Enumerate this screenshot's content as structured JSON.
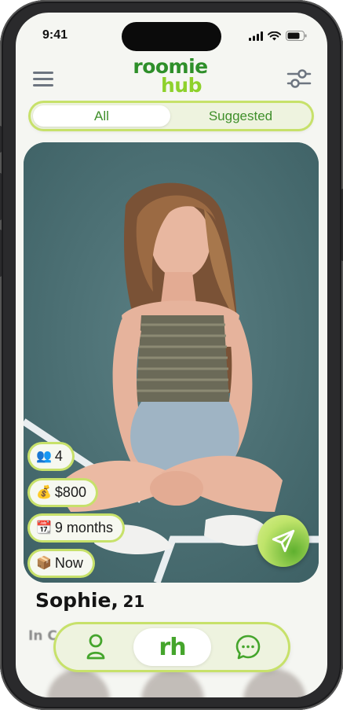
{
  "status_bar": {
    "time": "9:41"
  },
  "header": {
    "logo_line1": "roomie",
    "logo_line2": "hub",
    "menu_icon": "hamburger-menu-icon",
    "filter_icon": "sliders-icon"
  },
  "tabs": [
    {
      "label": "All",
      "active": true
    },
    {
      "label": "Suggested",
      "active": false
    }
  ],
  "profile": {
    "name": "Sophie",
    "separator": ",",
    "age": "21",
    "chips": [
      {
        "icon": "👥",
        "icon_name": "people-icon",
        "text": "4"
      },
      {
        "icon": "💰",
        "icon_name": "money-bag-icon",
        "text": "$800"
      },
      {
        "icon": "📆",
        "icon_name": "calendar-icon",
        "text": "9 months"
      },
      {
        "icon": "📦",
        "icon_name": "package-icon",
        "text": "Now"
      }
    ],
    "section_peek": "In C"
  },
  "bottom_nav": {
    "center_label": "rh",
    "left_icon": "profile-icon",
    "right_icon": "chat-icon"
  },
  "colors": {
    "brand_dark_green": "#2e8f2a",
    "brand_light_green": "#8ed12c",
    "accent_outline": "#c7e16a",
    "tab_text": "#3f8f2a"
  }
}
